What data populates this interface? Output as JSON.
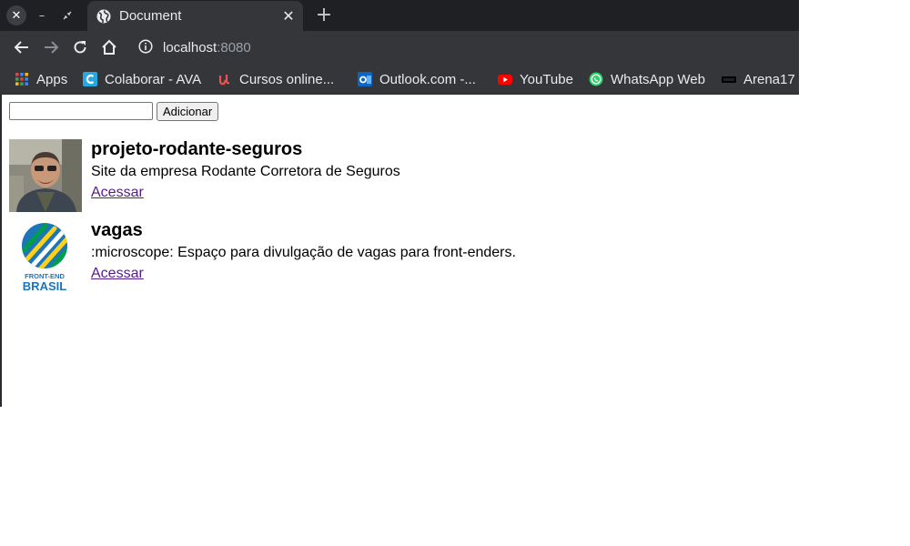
{
  "tab": {
    "title": "Document"
  },
  "address_bar": {
    "host": "localhost",
    "port": ":8080"
  },
  "bookmarks": [
    {
      "label": "Apps",
      "icon": "apps-grid-icon"
    },
    {
      "label": "Colaborar - AVA",
      "icon": "colaborar-icon"
    },
    {
      "label": "Cursos online...",
      "icon": "udemy-icon"
    },
    {
      "label": "Outlook.com -...",
      "icon": "outlook-icon"
    },
    {
      "label": "YouTube",
      "icon": "youtube-icon"
    },
    {
      "label": "WhatsApp Web",
      "icon": "whatsapp-icon"
    },
    {
      "label": "Arena17",
      "icon": "arena-icon"
    }
  ],
  "form": {
    "input_value": "",
    "button_label": "Adicionar"
  },
  "repos": [
    {
      "name": "projeto-rodante-seguros",
      "description": "Site da empresa Rodante Corretora de Seguros",
      "link_label": "Acessar",
      "avatar": "person-photo"
    },
    {
      "name": "vagas",
      "description": ":microscope: Espaço para divulgação de vagas para front-enders.",
      "link_label": "Acessar",
      "avatar": "frontend-brasil-logo",
      "logo_text": [
        "FRONT-END",
        "BRASIL"
      ]
    }
  ],
  "colors": {
    "tabstrip": "#1f2023",
    "toolbar": "#35363a",
    "link_visited": "#551a8b",
    "logo_blue": "#1b75bb",
    "logo_green": "#009e49",
    "logo_yellow": "#fcd116"
  }
}
